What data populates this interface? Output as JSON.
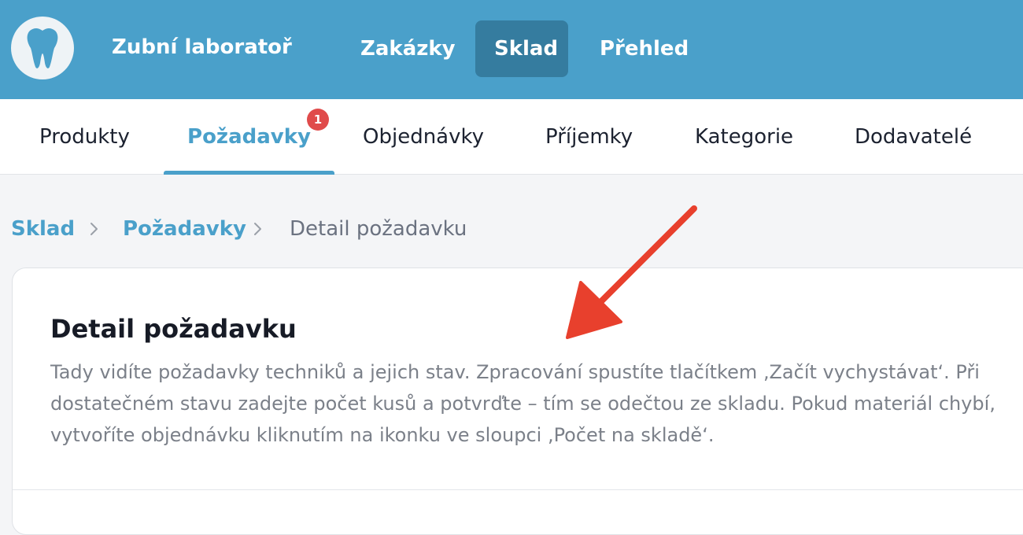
{
  "app": {
    "title": "Zubní laboratoř",
    "logo_icon": "tooth-icon"
  },
  "topnav": {
    "items": [
      {
        "label": "Zakázky"
      },
      {
        "label": "Sklad"
      },
      {
        "label": "Přehled"
      }
    ],
    "active": "Sklad"
  },
  "subnav": {
    "items": [
      {
        "label": "Produkty"
      },
      {
        "label": "Požadavky",
        "badge": "1"
      },
      {
        "label": "Objednávky"
      },
      {
        "label": "Příjemky"
      },
      {
        "label": "Kategorie"
      },
      {
        "label": "Dodavatelé"
      }
    ],
    "active": "Požadavky"
  },
  "breadcrumb": {
    "items": [
      {
        "label": "Sklad"
      },
      {
        "label": "Požadavky"
      }
    ],
    "current": "Detail požadavku"
  },
  "card": {
    "title": "Detail požadavku",
    "description": "Tady vidíte požadavky techniků a jejich stav. Zpracování spustíte tlačítkem ‚Začít vychystávat‘. Při dostatečném stavu zadejte počet kusů a potvrďte – tím se odečtou ze skladu. Pokud materiál chybí, vytvoříte objednávku kliknutím na ikonku ve sloupci ‚Počet na skladě‘."
  },
  "colors": {
    "brand": "#4aa0ca",
    "topnav_active": "#357c9f",
    "badge": "#e04b4b",
    "annotation_arrow": "#e8402d"
  }
}
